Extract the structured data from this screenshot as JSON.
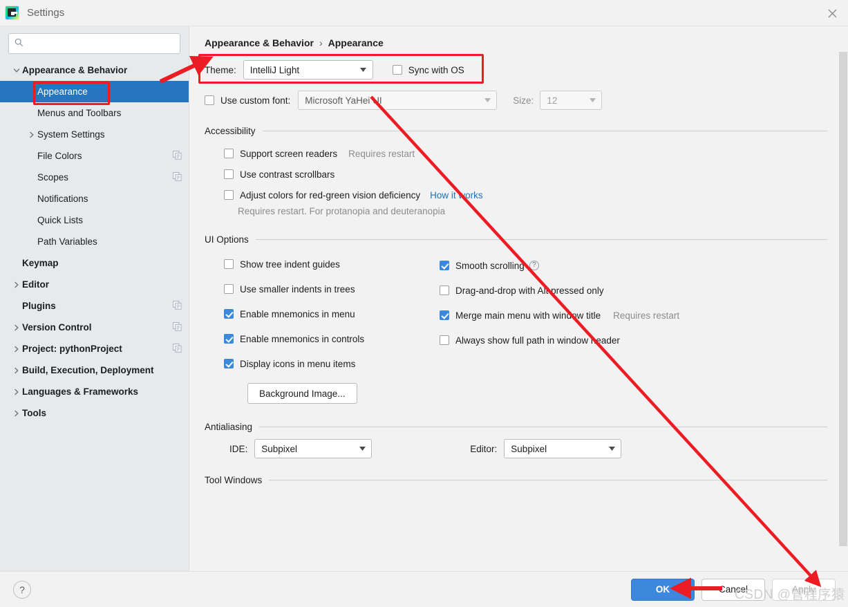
{
  "window": {
    "title": "Settings",
    "app_icon": "pycharm-icon",
    "close_icon": "close-icon"
  },
  "search": {
    "value": "",
    "placeholder": "",
    "icon": "search-icon"
  },
  "sidebar": {
    "items": [
      {
        "label": "Appearance & Behavior",
        "level": 0,
        "bold": true,
        "arrow": "chevron-down",
        "selected": false,
        "copy_icon": false
      },
      {
        "label": "Appearance",
        "level": 1,
        "bold": false,
        "arrow": "none",
        "selected": true,
        "copy_icon": false
      },
      {
        "label": "Menus and Toolbars",
        "level": 1,
        "bold": false,
        "arrow": "none",
        "selected": false,
        "copy_icon": false
      },
      {
        "label": "System Settings",
        "level": 1,
        "bold": false,
        "arrow": "chevron-right",
        "selected": false,
        "copy_icon": false
      },
      {
        "label": "File Colors",
        "level": 1,
        "bold": false,
        "arrow": "none",
        "selected": false,
        "copy_icon": true
      },
      {
        "label": "Scopes",
        "level": 1,
        "bold": false,
        "arrow": "none",
        "selected": false,
        "copy_icon": true
      },
      {
        "label": "Notifications",
        "level": 1,
        "bold": false,
        "arrow": "none",
        "selected": false,
        "copy_icon": false
      },
      {
        "label": "Quick Lists",
        "level": 1,
        "bold": false,
        "arrow": "none",
        "selected": false,
        "copy_icon": false
      },
      {
        "label": "Path Variables",
        "level": 1,
        "bold": false,
        "arrow": "none",
        "selected": false,
        "copy_icon": false
      },
      {
        "label": "Keymap",
        "level": 0,
        "bold": true,
        "arrow": "none",
        "selected": false,
        "copy_icon": false
      },
      {
        "label": "Editor",
        "level": 0,
        "bold": true,
        "arrow": "chevron-right",
        "selected": false,
        "copy_icon": false
      },
      {
        "label": "Plugins",
        "level": 0,
        "bold": true,
        "arrow": "none",
        "selected": false,
        "copy_icon": true
      },
      {
        "label": "Version Control",
        "level": 0,
        "bold": true,
        "arrow": "chevron-right",
        "selected": false,
        "copy_icon": true
      },
      {
        "label": "Project: pythonProject",
        "level": 0,
        "bold": true,
        "arrow": "chevron-right",
        "selected": false,
        "copy_icon": true
      },
      {
        "label": "Build, Execution, Deployment",
        "level": 0,
        "bold": true,
        "arrow": "chevron-right",
        "selected": false,
        "copy_icon": false
      },
      {
        "label": "Languages & Frameworks",
        "level": 0,
        "bold": true,
        "arrow": "chevron-right",
        "selected": false,
        "copy_icon": false
      },
      {
        "label": "Tools",
        "level": 0,
        "bold": true,
        "arrow": "chevron-right",
        "selected": false,
        "copy_icon": false
      }
    ]
  },
  "breadcrumb": {
    "parent": "Appearance & Behavior",
    "separator": "›",
    "current": "Appearance"
  },
  "theme": {
    "label": "Theme:",
    "value": "IntelliJ Light",
    "sync_label": "Sync with OS",
    "sync_checked": false
  },
  "font": {
    "custom_label": "Use custom font:",
    "custom_checked": false,
    "family": "Microsoft YaHei UI",
    "size_label": "Size:",
    "size_value": "12",
    "disabled": true
  },
  "accessibility": {
    "title": "Accessibility",
    "options": [
      {
        "label": "Support screen readers",
        "checked": false,
        "note": "Requires restart",
        "link": ""
      },
      {
        "label": "Use contrast scrollbars",
        "checked": false,
        "note": "",
        "link": ""
      },
      {
        "label": "Adjust colors for red-green vision deficiency",
        "checked": false,
        "note": "",
        "link": "How it works"
      }
    ],
    "hint": "Requires restart. For protanopia and deuteranopia"
  },
  "ui_options": {
    "title": "UI Options",
    "left": [
      {
        "label": "Show tree indent guides",
        "checked": false
      },
      {
        "label": "Use smaller indents in trees",
        "checked": false
      },
      {
        "label": "Enable mnemonics in menu",
        "checked": true
      },
      {
        "label": "Enable mnemonics in controls",
        "checked": true
      },
      {
        "label": "Display icons in menu items",
        "checked": true
      }
    ],
    "right": [
      {
        "label": "Smooth scrolling",
        "checked": true,
        "help": true,
        "note": ""
      },
      {
        "label": "Drag-and-drop with Alt pressed only",
        "checked": false,
        "help": false,
        "note": ""
      },
      {
        "label": "Merge main menu with window title",
        "checked": true,
        "help": false,
        "note": "Requires restart"
      },
      {
        "label": "Always show full path in window header",
        "checked": false,
        "help": false,
        "note": ""
      }
    ],
    "background_image_button": "Background Image..."
  },
  "antialiasing": {
    "title": "Antialiasing",
    "ide_label": "IDE:",
    "ide_value": "Subpixel",
    "editor_label": "Editor:",
    "editor_value": "Subpixel"
  },
  "tool_windows": {
    "title": "Tool Windows"
  },
  "footer": {
    "help_icon": "question-mark-icon",
    "ok": "OK",
    "cancel": "Cancel",
    "apply": "Apply"
  },
  "annotations": {
    "watermark": "CSDN @管程序猿",
    "highlight_color": "#ec1c24"
  }
}
